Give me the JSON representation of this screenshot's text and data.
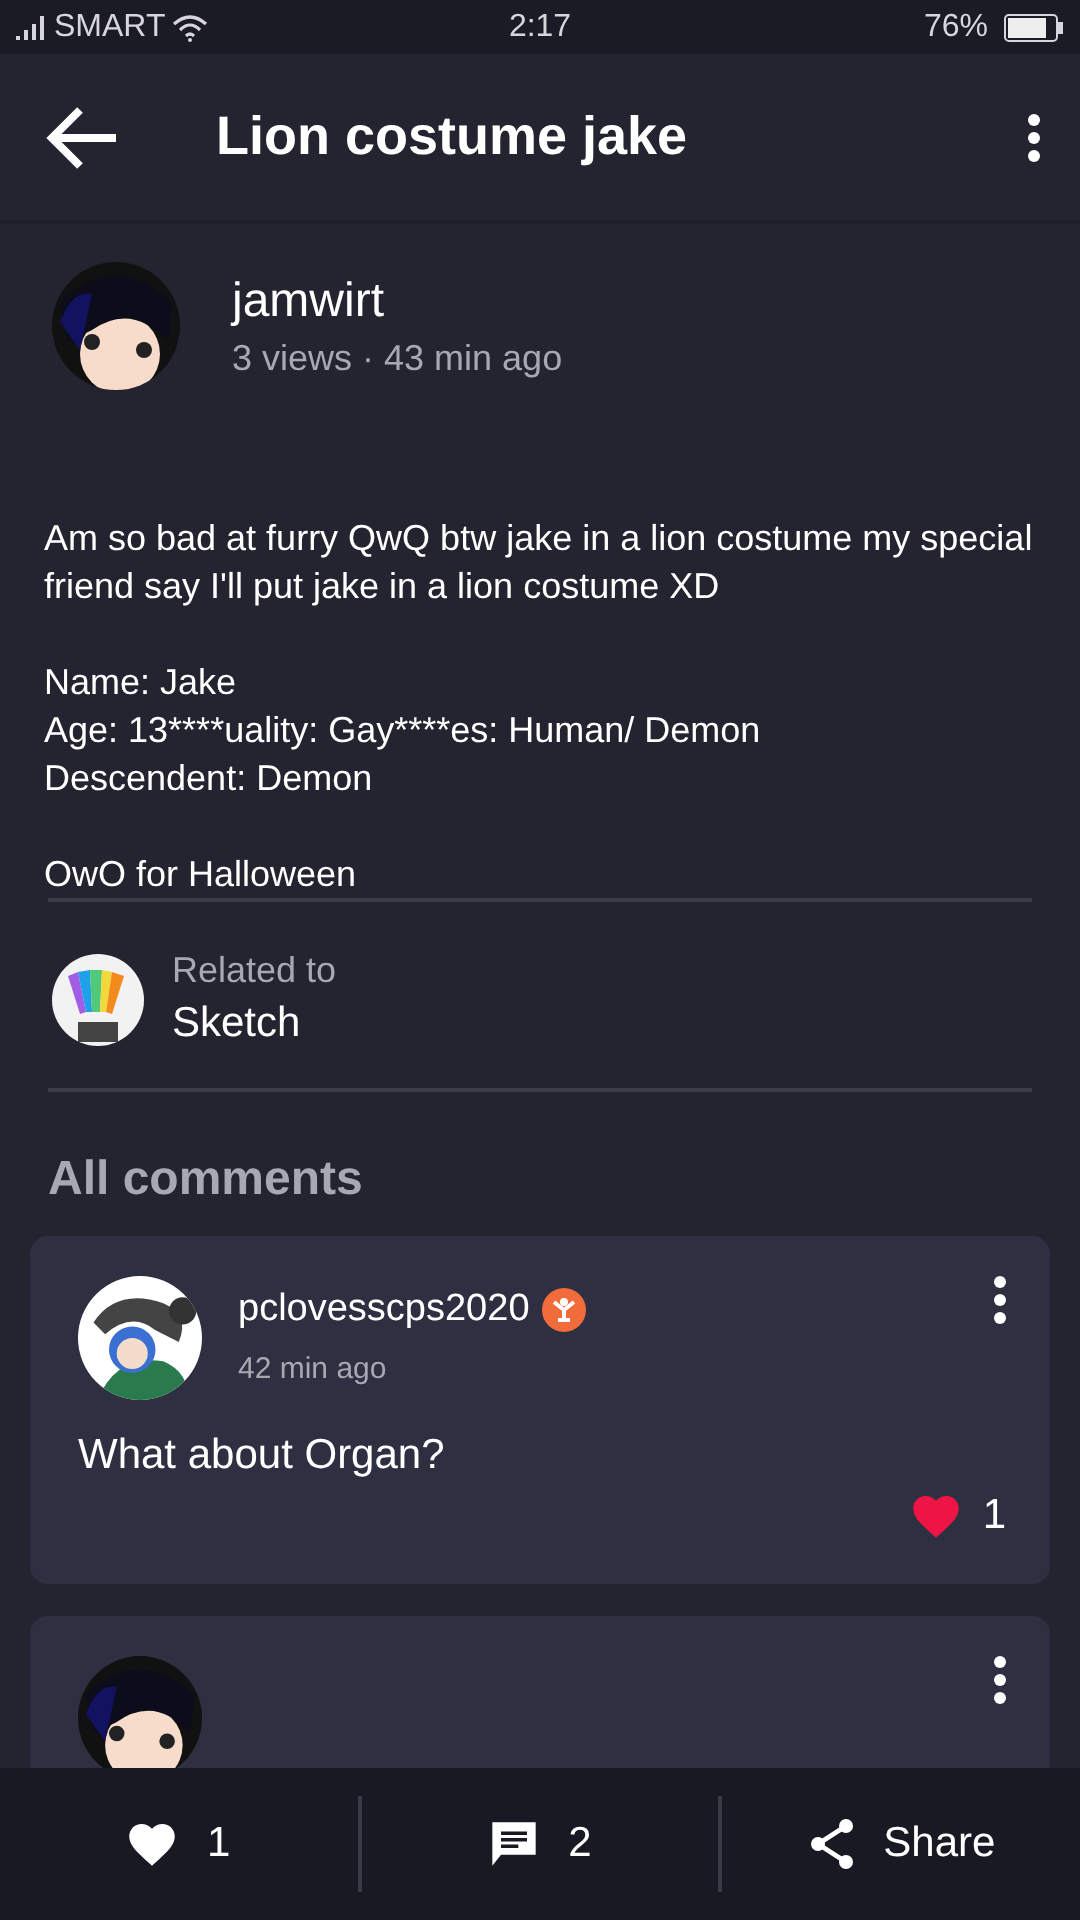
{
  "status_bar": {
    "carrier": "SMART",
    "time": "2:17",
    "battery": "76%"
  },
  "app_bar": {
    "title": "Lion costume jake"
  },
  "post": {
    "author": "jamwirt",
    "meta": "3 views · 43 min ago",
    "paragraphs": [
      "Am so bad at furry QwQ btw jake in a lion costume my special friend say I'll put jake in a lion costume XD",
      "Name: Jake\nAge: 13****uality: Gay****es: Human/ Demon\nDescendent: Demon",
      "OwO for Halloween"
    ]
  },
  "related": {
    "label": "Related to",
    "name": "Sketch"
  },
  "comments_heading": "All comments",
  "comments": [
    {
      "kind": "full",
      "author": "pclovesscps2020",
      "badge": true,
      "time": "42 min ago",
      "text": "What about Organ?",
      "likes": "1"
    },
    {
      "kind": "cut_off"
    }
  ],
  "bottom_bar": {
    "likes": "1",
    "comments": "2",
    "share": "Share"
  }
}
